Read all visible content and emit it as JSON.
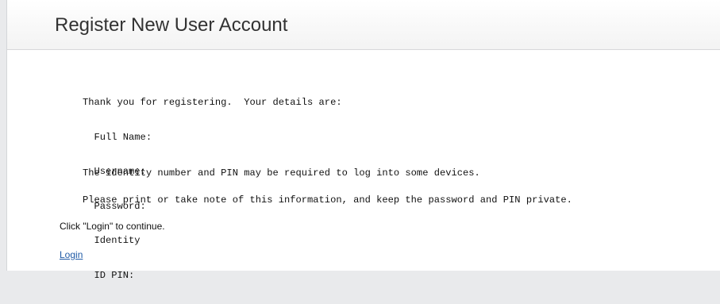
{
  "header": {
    "title": "Register New User Account"
  },
  "confirmation": {
    "intro": "Thank you for registering.  Your details are:",
    "fields": [
      {
        "label": "Full Name:"
      },
      {
        "label": "Username:"
      },
      {
        "label": "Password:"
      },
      {
        "label": "Identity"
      },
      {
        "label": "ID PIN:"
      }
    ],
    "identity_note": "The identity number and PIN may be required to log into some devices.",
    "print_note": "Please print or take note of this information, and keep the password and PIN private."
  },
  "footer": {
    "continue_text": "Click \"Login\" to continue.",
    "login_link": "Login"
  },
  "colors": {
    "link": "#1f5aa6",
    "text": "#111111",
    "title": "#333333",
    "page_background": "#e9eaec"
  }
}
